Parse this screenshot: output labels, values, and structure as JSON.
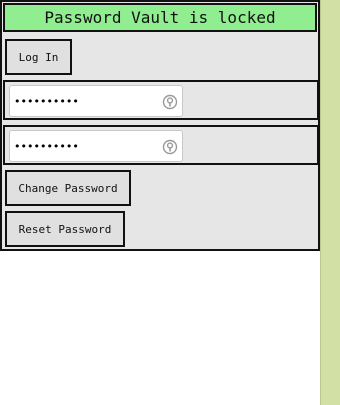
{
  "status": {
    "text": "Password Vault is locked"
  },
  "buttons": {
    "login": "Log In",
    "change_password": "Change Password",
    "reset_password": "Reset Password"
  },
  "fields": [
    {
      "value": "••••••••••"
    },
    {
      "value": "••••••••••"
    }
  ],
  "icons": {
    "reveal": "key-reveal-icon"
  },
  "colors": {
    "status_bg": "#90ee90",
    "panel_bg": "#e6e6e6",
    "scrollbar": "#d2e0a6"
  }
}
